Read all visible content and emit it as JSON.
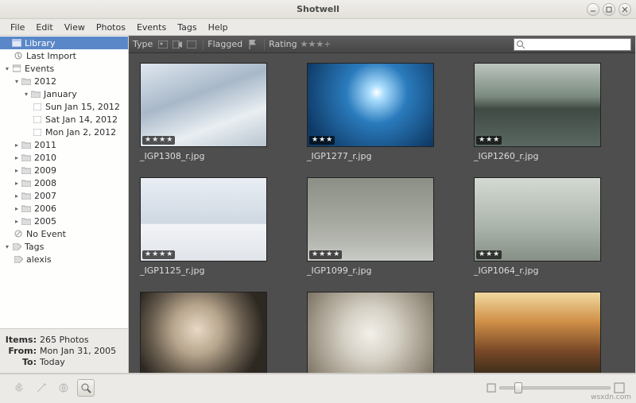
{
  "window": {
    "title": "Shotwell"
  },
  "menu": {
    "items": [
      "File",
      "Edit",
      "View",
      "Photos",
      "Events",
      "Tags",
      "Help"
    ]
  },
  "sidebar": {
    "library": "Library",
    "last_import": "Last Import",
    "events": "Events",
    "years": {
      "y2012": "2012",
      "jan": "January",
      "d15": "Sun Jan 15, 2012",
      "d14": "Sat Jan 14, 2012",
      "d02": "Mon Jan 2, 2012",
      "y2011": "2011",
      "y2010": "2010",
      "y2009": "2009",
      "y2008": "2008",
      "y2007": "2007",
      "y2006": "2006",
      "y2005": "2005"
    },
    "no_event": "No Event",
    "tags": "Tags",
    "tag_alexis": "alexis"
  },
  "meta": {
    "items_label": "Items:",
    "items_value": "265 Photos",
    "from_label": "From:",
    "from_value": "Mon Jan 31, 2005",
    "to_label": "To:",
    "to_value": "Today"
  },
  "toolbar": {
    "type_label": "Type",
    "flagged_label": "Flagged",
    "rating_label": "Rating",
    "search_placeholder": ""
  },
  "photos": {
    "r1": [
      {
        "file": "_IGP1308_r.jpg",
        "rating": 4,
        "cls": "ph-snow"
      },
      {
        "file": "_IGP1277_r.jpg",
        "rating": 3,
        "cls": "ph-blue"
      },
      {
        "file": "_IGP1260_r.jpg",
        "rating": 3,
        "cls": "ph-refl"
      }
    ],
    "r2": [
      {
        "file": "_IGP1125_r.jpg",
        "rating": 4,
        "cls": "ph-trees"
      },
      {
        "file": "_IGP1099_r.jpg",
        "rating": 4,
        "cls": "ph-path"
      },
      {
        "file": "_IGP1064_r.jpg",
        "rating": 3,
        "cls": "ph-frost"
      }
    ],
    "r3": [
      {
        "file": "",
        "rating": 0,
        "cls": "ph-mirror"
      },
      {
        "file": "",
        "rating": 0,
        "cls": "ph-fan"
      },
      {
        "file": "",
        "rating": 0,
        "cls": "ph-canopy"
      }
    ]
  },
  "watermark": "wsxdn.com"
}
